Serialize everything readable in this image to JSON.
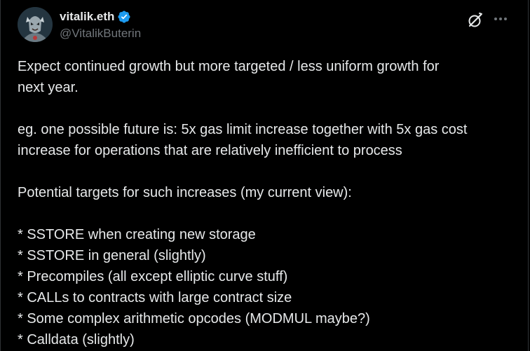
{
  "author": {
    "display_name": "vitalik.eth",
    "handle": "@VitalikButerin",
    "verified": true
  },
  "icons": {
    "avatar": "avatar-image",
    "verified": "verified-badge-icon",
    "grok": "grok-icon",
    "more": "more-options-icon"
  },
  "colors": {
    "background": "#000000",
    "text": "#e7e9ea",
    "secondary": "#71767b",
    "verified": "#1d9bf0"
  },
  "tweet": {
    "paragraph_1": [
      "Expect continued growth but more targeted / less uniform growth for",
      "next year."
    ],
    "paragraph_2": [
      "eg. one possible future is: 5x gas limit increase together with 5x gas cost",
      "increase for operations that are relatively inefficient to process"
    ],
    "paragraph_3": "Potential targets for such increases (my current view):",
    "list": [
      "* SSTORE when creating new storage",
      "* SSTORE in general (slightly)",
      "* Precompiles (all except elliptic curve stuff)",
      "* CALLs to contracts with large contract size",
      "* Some complex arithmetic opcodes (MODMUL maybe?)",
      "* Calldata (slightly)"
    ]
  }
}
